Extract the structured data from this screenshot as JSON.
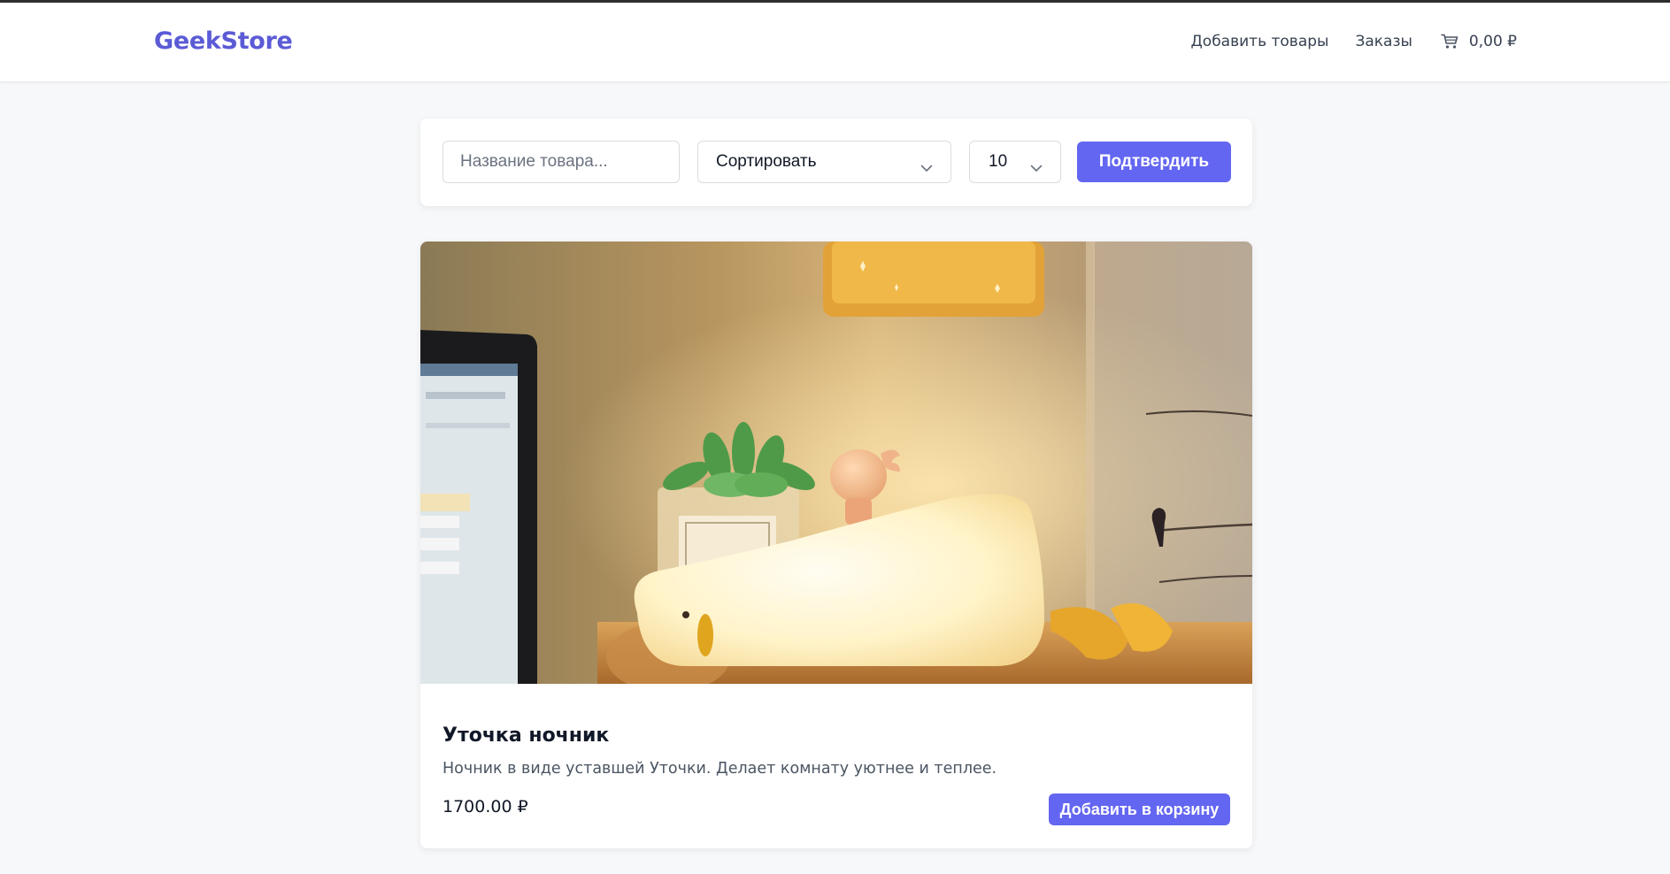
{
  "header": {
    "logo": "GeekStore",
    "nav": {
      "add_products": "Добавить товары",
      "orders": "Заказы",
      "cart_total": "0,00 ₽"
    }
  },
  "filters": {
    "search_placeholder": "Название товара...",
    "sort_label": "Сортировать",
    "limit_value": "10",
    "confirm_label": "Подтвердить"
  },
  "product": {
    "title": "Уточка ночник",
    "description": "Ночник в виде уставшей Уточки. Делает комнату уютнее и теплее.",
    "price": "1700.00 ₽",
    "add_to_cart_label": "Добавить в корзину"
  },
  "colors": {
    "accent": "#6366f1",
    "logo": "#5b5bd6",
    "background": "#f7f8fa"
  },
  "icons": {
    "cart": "cart-icon",
    "chevron": "chevron-down-icon"
  }
}
